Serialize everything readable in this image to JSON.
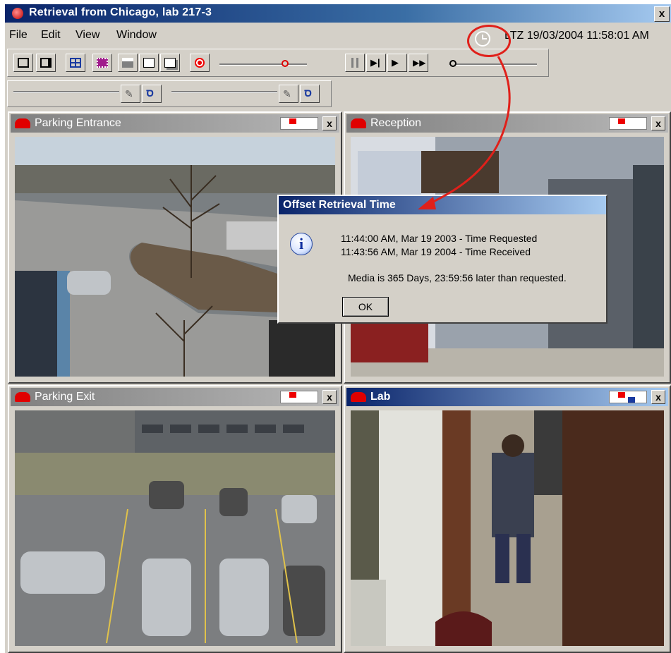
{
  "window": {
    "title": "Retrieval from Chicago, lab 217-3",
    "close_label": "x"
  },
  "menu": {
    "items": [
      "File",
      "Edit",
      "View",
      "Window"
    ]
  },
  "status": {
    "timestamp": "LTZ 19/03/2004 11:58:01 AM"
  },
  "panes": [
    {
      "title": "Parking Entrance",
      "active": false,
      "close_label": "x"
    },
    {
      "title": "Reception",
      "active": false,
      "close_label": "x"
    },
    {
      "title": "Parking Exit",
      "active": false,
      "close_label": "x"
    },
    {
      "title": "Lab",
      "active": true,
      "close_label": "x"
    }
  ],
  "dialog": {
    "title": "Offset Retrieval Time",
    "line1": "11:44:00 AM,  Mar 19 2003  - Time Requested",
    "line2": "11:43:56 AM,  Mar 19 2004  - Time Received",
    "message": "Media is 365 Days, 23:59:56 later than requested.",
    "ok_label": "OK"
  },
  "colors": {
    "title_active": "#0a246a",
    "annotation": "#e0201a",
    "face": "#d4d0c8"
  }
}
